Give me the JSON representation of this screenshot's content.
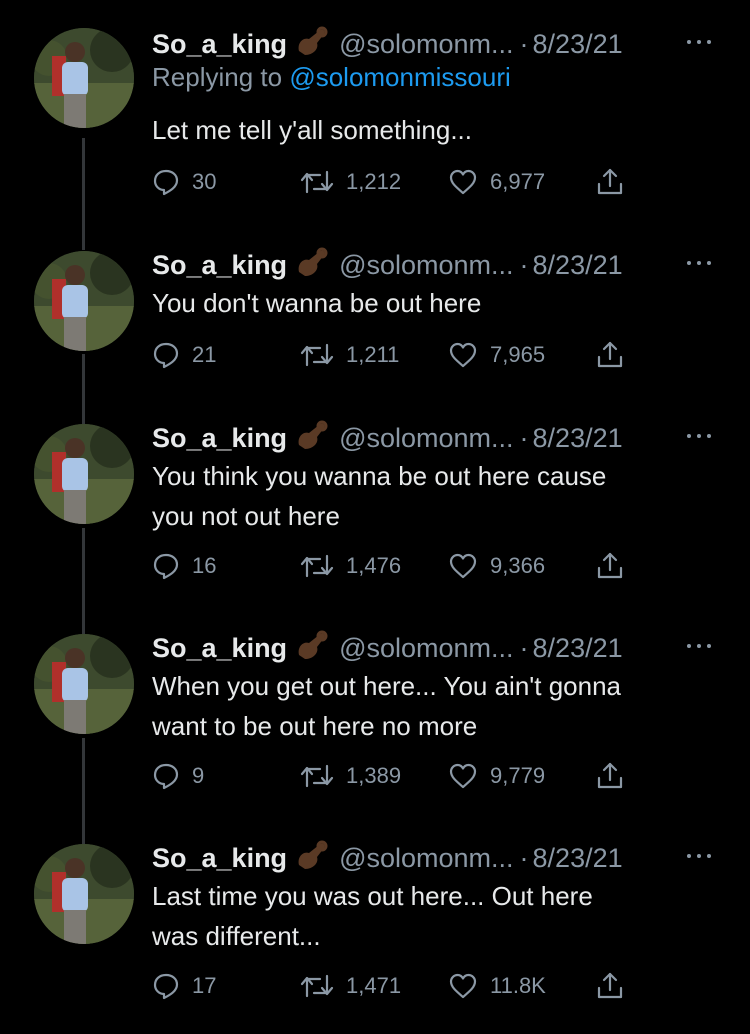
{
  "colors": {
    "background": "#000000",
    "text": "#e7e9ea",
    "muted": "#8b98a5",
    "link": "#1d9bf0",
    "thread_line": "#333639"
  },
  "tweets": [
    {
      "name": "So_a_king",
      "handle": "@solomonm...",
      "separator": "·",
      "date": "8/23/21",
      "replying_label": "Replying to",
      "replying_handle": "@solomonmissouri",
      "text_lines": [
        "Let me tell y'all something..."
      ],
      "replies": "30",
      "retweets": "1,212",
      "likes": "6,977"
    },
    {
      "name": "So_a_king",
      "handle": "@solomonm...",
      "separator": "·",
      "date": "8/23/21",
      "text_lines": [
        "You don't wanna be out here"
      ],
      "replies": "21",
      "retweets": "1,211",
      "likes": "7,965"
    },
    {
      "name": "So_a_king",
      "handle": "@solomonm...",
      "separator": "·",
      "date": "8/23/21",
      "text_lines": [
        "You think you wanna be out here cause",
        "you not out here"
      ],
      "replies": "16",
      "retweets": "1,476",
      "likes": "9,366"
    },
    {
      "name": "So_a_king",
      "handle": "@solomonm...",
      "separator": "·",
      "date": "8/23/21",
      "text_lines": [
        "When you get out here... You ain't gonna",
        "want to be out here no more"
      ],
      "replies": "9",
      "retweets": "1,389",
      "likes": "9,779"
    },
    {
      "name": "So_a_king",
      "handle": "@solomonm...",
      "separator": "·",
      "date": "8/23/21",
      "text_lines": [
        "Last time you was out here... Out here",
        "was different..."
      ],
      "replies": "17",
      "retweets": "1,471",
      "likes": "11.8K"
    }
  ]
}
